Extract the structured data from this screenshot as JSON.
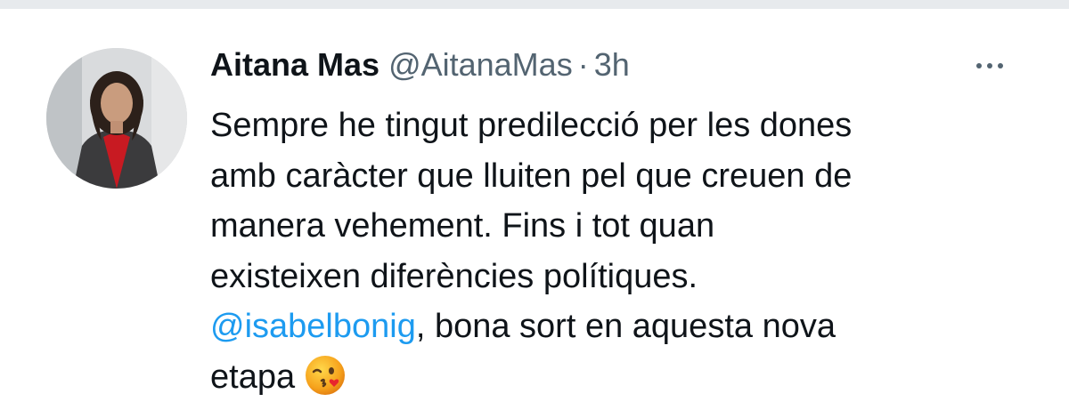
{
  "tweet": {
    "author": {
      "display_name": "Aitana Mas",
      "handle": "@AitanaMas"
    },
    "separator": "·",
    "timestamp": "3h",
    "more_icon": "more-horizontal-icon",
    "body_lines": [
      "Sempre he tingut predilecció per les dones",
      "amb caràcter que lluiten pel que creuen de",
      "manera vehement. Fins i tot quan",
      "existeixen diferències polítiques."
    ],
    "mention": "@isabelbonig",
    "mention_suffix": ", bona sort en aquesta nova",
    "last_line": "etapa",
    "emoji": "face-blowing-a-kiss-emoji"
  },
  "colors": {
    "text": "#0f1419",
    "secondary": "#536471",
    "link": "#1d9bf0",
    "divider": "#e7eaed"
  }
}
